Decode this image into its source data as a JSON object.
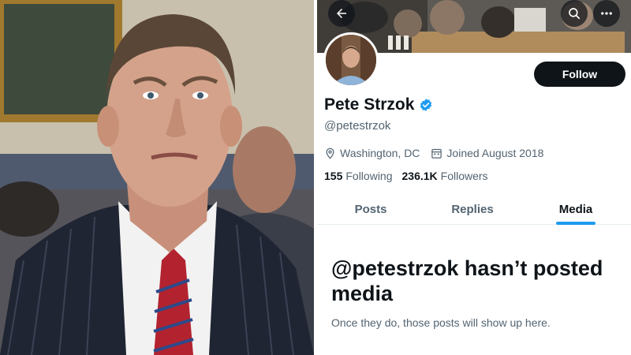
{
  "photo": {
    "description_icon": "person-portrait",
    "colors": {
      "suit": "#1f2533",
      "tie_red": "#b3232f",
      "tie_blue": "#2d4a8a",
      "shirt": "#f2f2f2",
      "skin": "#d4a28a"
    }
  },
  "profile": {
    "header": {
      "back_icon": "arrow-left-icon",
      "search_icon": "search-icon",
      "more_icon": "more-horizontal-icon"
    },
    "follow_label": "Follow",
    "display_name": "Pete Strzok",
    "verified_icon": "verified-badge-icon",
    "verified_color": "#1d9bf0",
    "handle": "@petestrzok",
    "location": "Washington, DC",
    "joined": "Joined August 2018",
    "stats": {
      "following_count": "155",
      "following_label": "Following",
      "followers_count": "236.1K",
      "followers_label": "Followers"
    },
    "tabs": [
      {
        "label": "Posts"
      },
      {
        "label": "Replies"
      },
      {
        "label": "Media"
      }
    ],
    "active_tab": "Media",
    "empty_state": {
      "title": "@petestrzok hasn’t posted media",
      "subtitle": "Once they do, those posts will show up here."
    }
  }
}
